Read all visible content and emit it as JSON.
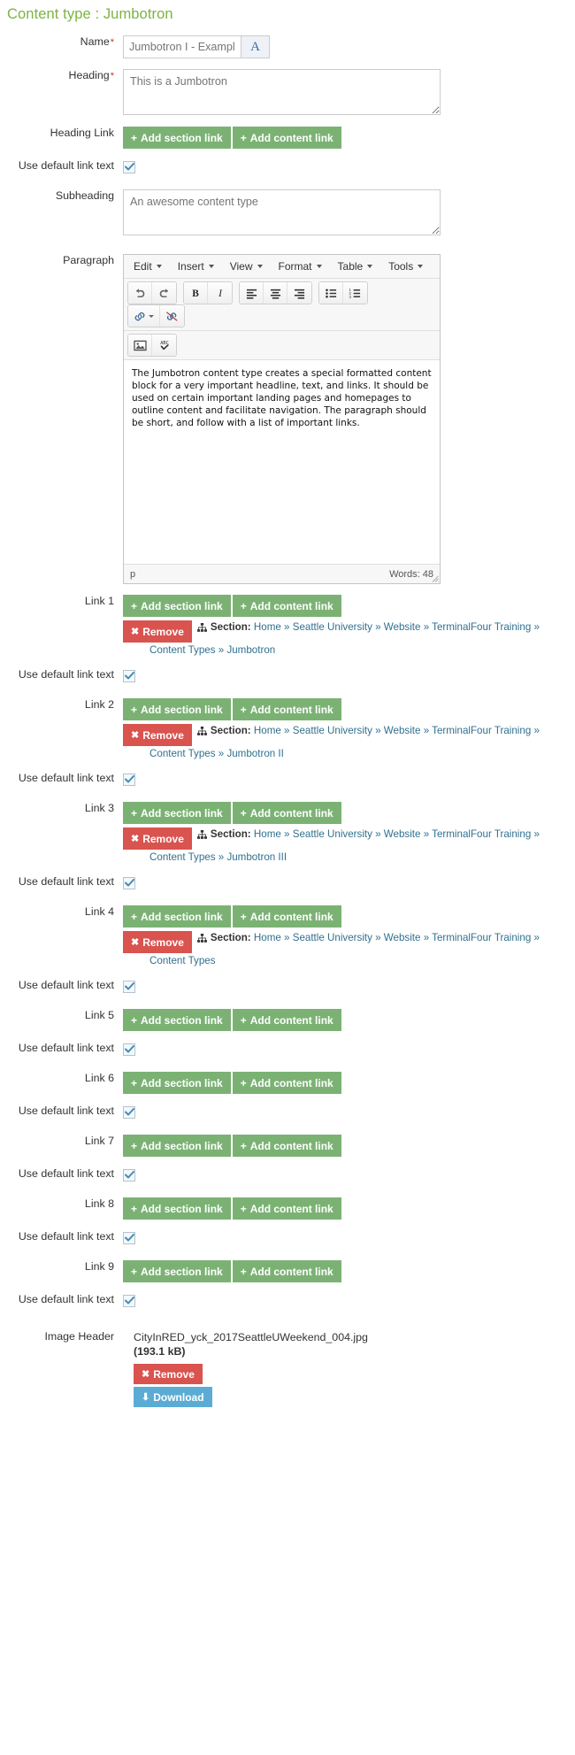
{
  "page": {
    "title": "Content type : Jumbotron",
    "title_color": "#7cb342"
  },
  "fields": {
    "name": {
      "label": "Name",
      "required": "*",
      "value": "Jumbotron I - Example",
      "placeholder": "Jumbotron I - Example",
      "lang_button": "A"
    },
    "heading": {
      "label": "Heading",
      "required": "*",
      "value": "This is a Jumbotron",
      "placeholder": "This is a Jumbotron"
    },
    "heading_link": {
      "label": "Heading Link"
    },
    "use_default_link_text": {
      "label": "Use default link text",
      "checked": true
    },
    "subheading": {
      "label": "Subheading",
      "value": "An awesome content type",
      "placeholder": "An awesome content type"
    },
    "paragraph": {
      "label": "Paragraph"
    },
    "image_header": {
      "label": "Image Header",
      "file_name": "CityInRED_yck_2017SeattleUWeekend_004.jpg",
      "file_size": "(193.1 kB)",
      "remove_label": "Remove",
      "download_label": "Download"
    }
  },
  "buttons": {
    "add_section_link": "Add section link",
    "add_content_link": "Add content link",
    "remove": "Remove",
    "download": "Download",
    "plus": "+",
    "xmark": "✖",
    "download_icon": "⬇"
  },
  "editor": {
    "menus": [
      {
        "label": "Edit"
      },
      {
        "label": "Insert"
      },
      {
        "label": "View"
      },
      {
        "label": "Format"
      },
      {
        "label": "Table"
      },
      {
        "label": "Tools"
      }
    ],
    "toolbar": [
      {
        "name": "undo-icon",
        "title": "Undo"
      },
      {
        "name": "redo-icon",
        "title": "Redo"
      },
      {
        "name": "bold-icon",
        "title": "Bold"
      },
      {
        "name": "italic-icon",
        "title": "Italic"
      },
      {
        "name": "align-left-icon",
        "title": "Align left"
      },
      {
        "name": "align-center-icon",
        "title": "Align center"
      },
      {
        "name": "align-right-icon",
        "title": "Align right"
      },
      {
        "name": "bullet-list-icon",
        "title": "Bullet list"
      },
      {
        "name": "numbered-list-icon",
        "title": "Numbered list"
      },
      {
        "name": "insert-link-icon",
        "title": "Insert link"
      },
      {
        "name": "unlink-icon",
        "title": "Remove link"
      },
      {
        "name": "insert-image-icon",
        "title": "Insert image"
      },
      {
        "name": "spellcheck-icon",
        "title": "Spellcheck"
      }
    ],
    "content": "The Jumbotron content type creates a special formatted content block for a very important headline, text, and links. It should be used on certain important landing pages and homepages to outline content and facilitate navigation. The paragraph should be short, and follow with a list of important links.",
    "path": "p",
    "word_count": "Words: 48"
  },
  "links": [
    {
      "label": "Link 1",
      "has_selection": true,
      "section_label": "Section:",
      "breadcrumb": "Home » Seattle University » Website » TerminalFour Training » Content Types » Jumbotron",
      "default_text_label": "Use default link text",
      "checked": true
    },
    {
      "label": "Link 2",
      "has_selection": true,
      "section_label": "Section:",
      "breadcrumb": "Home » Seattle University » Website » TerminalFour Training » Content Types » Jumbotron II",
      "default_text_label": "Use default link text",
      "checked": true
    },
    {
      "label": "Link 3",
      "has_selection": true,
      "section_label": "Section:",
      "breadcrumb": "Home » Seattle University » Website » TerminalFour Training » Content Types » Jumbotron III",
      "default_text_label": "Use default link text",
      "checked": true
    },
    {
      "label": "Link 4",
      "has_selection": true,
      "section_label": "Section:",
      "breadcrumb": "Home » Seattle University » Website » TerminalFour Training » Content Types",
      "default_text_label": "Use default link text",
      "checked": true
    },
    {
      "label": "Link 5",
      "has_selection": false,
      "default_text_label": "Use default link text",
      "checked": true
    },
    {
      "label": "Link 6",
      "has_selection": false,
      "default_text_label": "Use default link text",
      "checked": true
    },
    {
      "label": "Link 7",
      "has_selection": false,
      "default_text_label": "Use default link text",
      "checked": true
    },
    {
      "label": "Link 8",
      "has_selection": false,
      "default_text_label": "Use default link text",
      "checked": true
    },
    {
      "label": "Link 9",
      "has_selection": false,
      "default_text_label": "Use default link text",
      "checked": true
    }
  ],
  "colors": {
    "green": "#7bb274",
    "red": "#d9534f",
    "blue": "#5bacd4",
    "title": "#7cb342"
  }
}
